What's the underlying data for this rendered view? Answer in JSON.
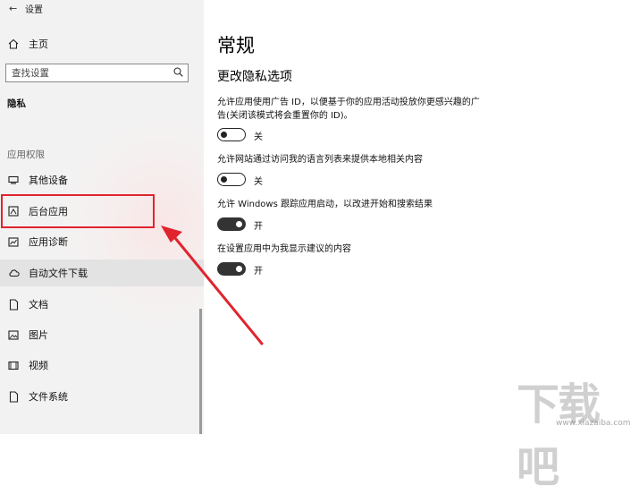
{
  "window": {
    "title": "设置"
  },
  "sidebar": {
    "home_label": "主页",
    "search_placeholder": "查找设置",
    "section_title": "隐私",
    "group_title": "应用权限",
    "items": [
      {
        "label": "其他设备",
        "icon": "devices-icon"
      },
      {
        "label": "后台应用",
        "icon": "background-apps-icon"
      },
      {
        "label": "应用诊断",
        "icon": "diagnostics-icon"
      },
      {
        "label": "自动文件下载",
        "icon": "cloud-icon"
      },
      {
        "label": "文档",
        "icon": "document-icon"
      },
      {
        "label": "图片",
        "icon": "picture-icon"
      },
      {
        "label": "视频",
        "icon": "video-icon"
      },
      {
        "label": "文件系统",
        "icon": "file-icon"
      }
    ]
  },
  "main": {
    "title": "常规",
    "subtitle": "更改隐私选项",
    "options": [
      {
        "text_line1": "允许应用使用广告 ID，以便基于你的应用活动投放你更感兴趣的广",
        "text_line2": "告(关闭该模式将会重置你的 ID)。",
        "state": "关",
        "on": false
      },
      {
        "text_line1": "允许网站通过访问我的语言列表来提供本地相关内容",
        "state": "关",
        "on": false
      },
      {
        "text_line1": "允许 Windows 跟踪应用启动，以改进开始和搜索结果",
        "state": "开",
        "on": true
      },
      {
        "text_line1": "在设置应用中为我显示建议的内容",
        "state": "开",
        "on": true
      }
    ]
  },
  "annotation": {
    "color": "#e0242e"
  },
  "watermark": {
    "text": "下载吧",
    "url": "www.xiazaiba.com"
  }
}
